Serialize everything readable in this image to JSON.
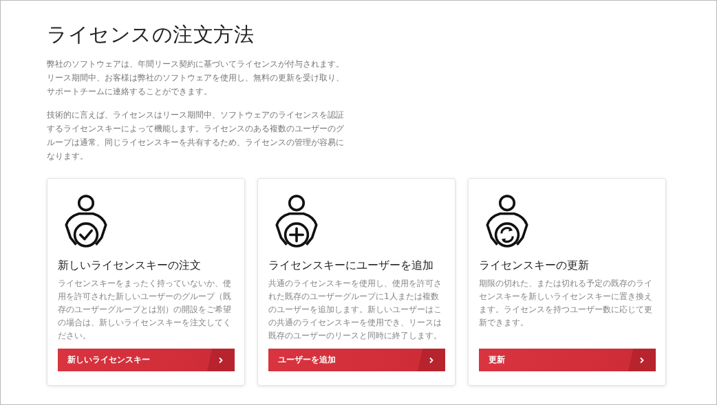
{
  "title": "ライセンスの注文方法",
  "paragraphs": [
    "弊社のソフトウェアは、年間リース契約に基づいてライセンスが付与されます。リース期間中、お客様は弊社のソフトウェアを使用し、無料の更新を受け取り、サポートチームに連絡することができます。",
    "技術的に言えば、ライセンスはリース期間中、ソフトウェアのライセンスを認証するライセンスキーによって機能します。ライセンスのある複数のユーザーのグループは通常、同じライセンスキーを共有するため、ライセンスの管理が容易になります。"
  ],
  "cards": [
    {
      "kind": "check",
      "title": "新しいライセンスキーの注文",
      "text": "ライセンスキーをまったく持っていないか、使用を許可された新しいユーザーのグループ（既存のユーザーグループとは別）の開設をご希望の場合は、新しいライセンスキーを注文してください。",
      "button": "新しいライセンスキー"
    },
    {
      "kind": "plus",
      "title": "ライセンスキーにユーザーを追加",
      "text": "共通のライセンスキーを使用し、使用を許可された既存のユーザーグループに1人または複数のユーザーを追加します。新しいユーザーはこの共通のライセンスキーを使用でき、リースは既存のユーザーのリースと同時に終了します。",
      "button": "ユーザーを追加"
    },
    {
      "kind": "refresh",
      "title": "ライセンスキーの更新",
      "text": "期限の切れた、または切れる予定の既存のライセンスキーを新しいライセンスキーに置き換えます。ライセンスを持つユーザー数に応じて更新できます。",
      "button": "更新"
    }
  ]
}
